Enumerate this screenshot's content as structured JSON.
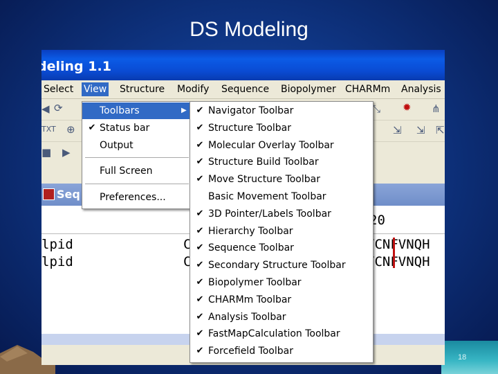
{
  "slide": {
    "title": "DS Modeling",
    "number": "18"
  },
  "window": {
    "title": "deling 1.1"
  },
  "menubar": [
    "Select",
    "View",
    "Structure",
    "Modify",
    "Sequence",
    "Biopolymer",
    "CHARMm",
    "Analysis"
  ],
  "view_menu": {
    "toolbars": "Toolbars",
    "status_bar": "Status bar",
    "output": "Output",
    "full_screen": "Full Screen",
    "preferences": "Preferences..."
  },
  "toolbars_submenu": [
    {
      "label": "Navigator Toolbar",
      "checked": true
    },
    {
      "label": "Structure Toolbar",
      "checked": true
    },
    {
      "label": "Molecular Overlay Toolbar",
      "checked": true
    },
    {
      "label": "Structure Build Toolbar",
      "checked": true
    },
    {
      "label": "Move Structure Toolbar",
      "checked": true
    },
    {
      "label": "Basic Movement Toolbar",
      "checked": false
    },
    {
      "label": "3D Pointer/Labels Toolbar",
      "checked": true
    },
    {
      "label": "Hierarchy Toolbar",
      "checked": true
    },
    {
      "label": "Sequence Toolbar",
      "checked": true
    },
    {
      "label": "Secondary Structure Toolbar",
      "checked": true
    },
    {
      "label": "Biopolymer Toolbar",
      "checked": true
    },
    {
      "label": "CHARMm Toolbar",
      "checked": true
    },
    {
      "label": "Analysis Toolbar",
      "checked": true
    },
    {
      "label": "FastMapCalculation Toolbar",
      "checked": true
    },
    {
      "label": "Forcefield Toolbar",
      "checked": true
    }
  ],
  "sequence_window": {
    "title": "Seq",
    "ruler_label": "20",
    "rows": [
      {
        "name": "lpid",
        "left": "C",
        "right": "YCNFVNQH"
      },
      {
        "name": "lpid",
        "left": "C",
        "right": "YCNFVNQH"
      }
    ]
  },
  "toolbar_icons": [
    "nav-back-icon",
    "rotate-icon",
    "text-icon",
    "globe-icon",
    "stop-icon",
    "play-icon",
    "spin-icon",
    "atom-icon",
    "align-icon",
    "bond-icon"
  ],
  "colors": {
    "menu_highlight": "#316ac5",
    "titlebar": "#0b5be6",
    "marker": "#c01010"
  }
}
